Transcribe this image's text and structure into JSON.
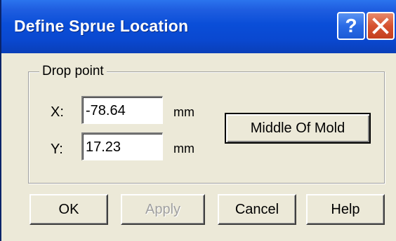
{
  "window": {
    "title": "Define Sprue Location",
    "help_glyph": "?",
    "close_glyph": "✕"
  },
  "drop_point": {
    "legend": "Drop point",
    "x_label": "X:",
    "x_value": "-78.64",
    "y_label": "Y:",
    "y_value": "17.23",
    "x_unit": "mm",
    "y_unit": "mm",
    "middle_button": "Middle Of Mold"
  },
  "buttons": {
    "ok": "OK",
    "apply": "Apply",
    "cancel": "Cancel",
    "help": "Help"
  },
  "colors": {
    "titlebar": "#0a4ed8",
    "dialog_bg": "#ece9d8",
    "close_button": "#d6512f"
  },
  "icons": {
    "help": "help-icon",
    "close": "close-icon"
  }
}
